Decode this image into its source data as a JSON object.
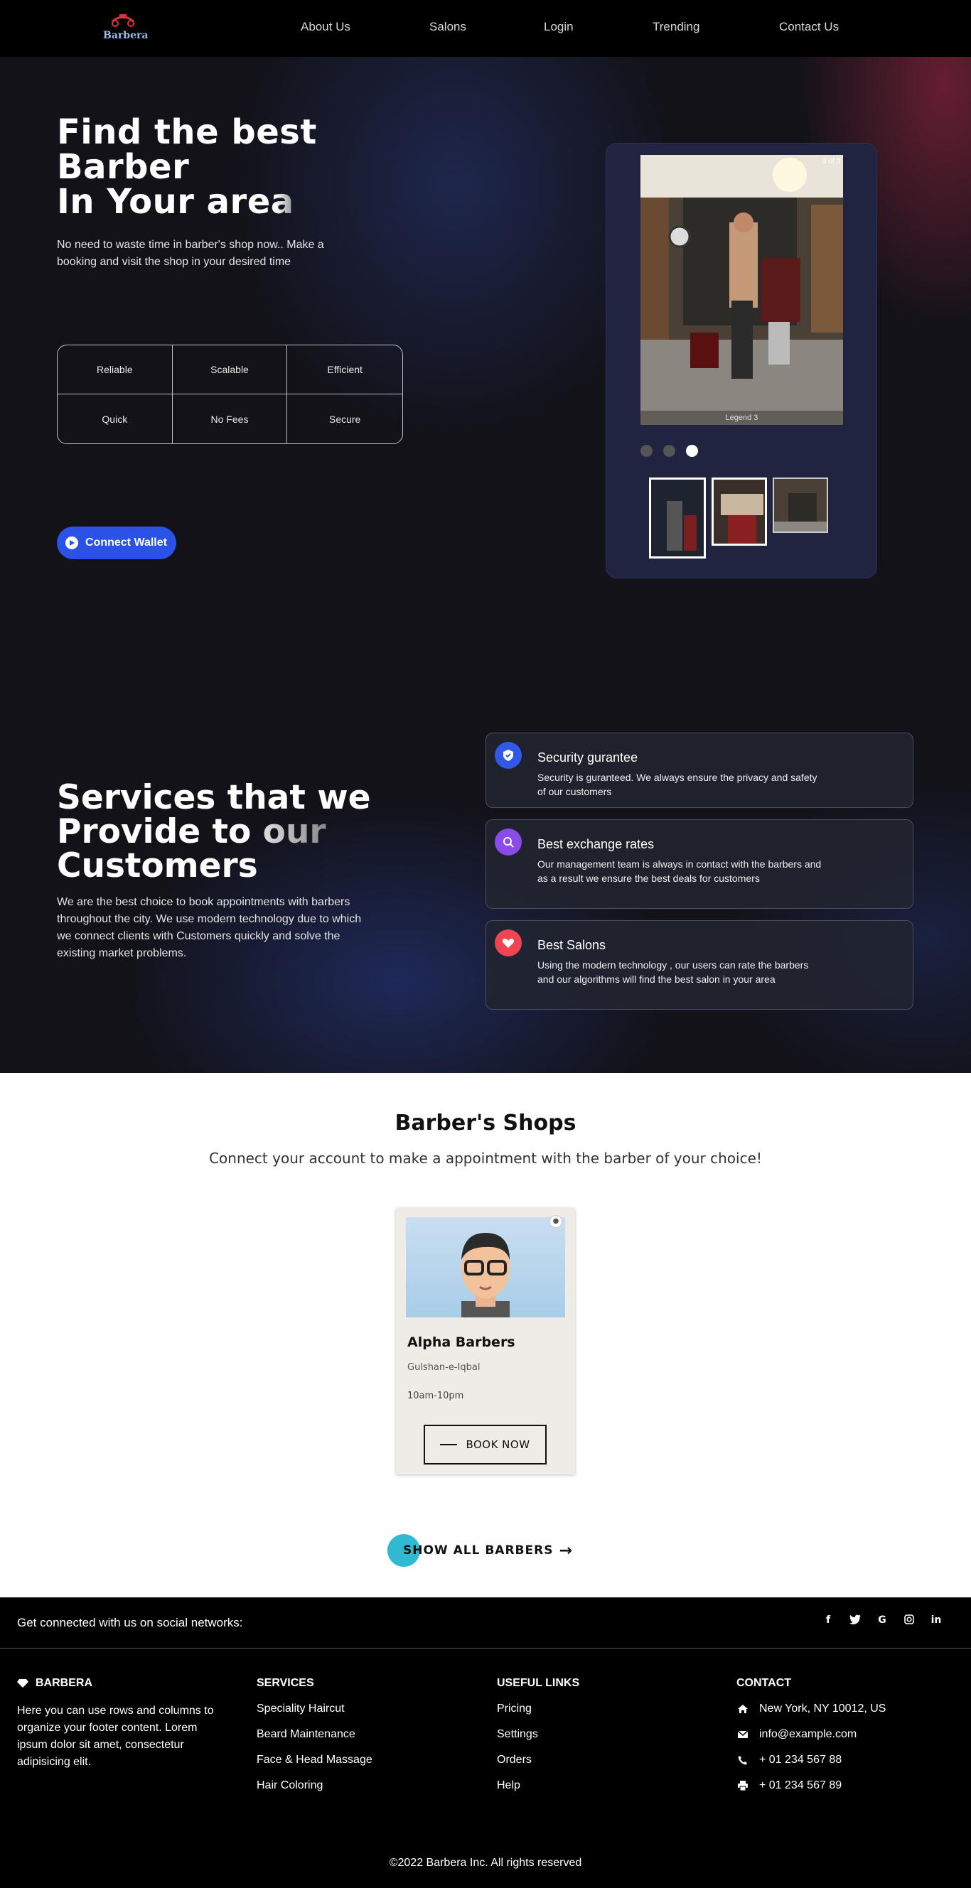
{
  "nav": {
    "logo_text": "Barbera",
    "items": [
      "About Us",
      "Salons",
      "Login",
      "Trending",
      "Contact Us"
    ]
  },
  "hero": {
    "title_line1": "Find the best",
    "title_line2": "Barber",
    "title_line3a": "In Your ar",
    "title_line3b": "ea",
    "subtitle": "No need to waste time in barber's shop now.. Make a booking and visit the shop in your desired time",
    "features": [
      "Reliable",
      "Scalable",
      "Efficient",
      "Quick",
      "No Fees",
      "Secure"
    ],
    "wallet_button": "Connect Wallet"
  },
  "carousel": {
    "counter": "3 of 3",
    "legend": "Legend 3",
    "active_slide": 3
  },
  "services": {
    "title_line1": "Services that we",
    "title_line2a": "Provide to ",
    "title_line2b": "our",
    "title_line3": "Customers",
    "subtitle": "We are the best choice to book appointments with barbers throughout the city. We use modern technology due to which we connect clients with Customers quickly and solve the existing market problems.",
    "cards": [
      {
        "title": "Security gurantee",
        "text": "Security is guranteed. We always ensure the privacy and safety of our customers",
        "icon": "shield-icon",
        "color": "#3159e6"
      },
      {
        "title": "Best exchange rates",
        "text": "Our management team is always in contact with the barbers and as a result we ensure the best deals for customers",
        "icon": "search-icon",
        "color": "#8a4be8"
      },
      {
        "title": "Best Salons",
        "text": "Using the modern technology , our users can rate the barbers and our algorithms will find the best salon in your area",
        "icon": "heart-icon",
        "color": "#ef4452"
      }
    ]
  },
  "shops": {
    "title": "Barber's Shops",
    "subtitle": "Connect your account to make a appointment with the barber of your choice!",
    "card": {
      "name": "Alpha Barbers",
      "location": "Gulshan-e-Iqbal",
      "hours": "10am-10pm",
      "button": "BOOK NOW"
    },
    "show_all": "SHOW ALL BARBERS"
  },
  "footer": {
    "social_text": "Get connected with us on social networks:",
    "social_icons": [
      "facebook-icon",
      "twitter-icon",
      "google-icon",
      "instagram-icon",
      "linkedin-icon"
    ],
    "brand": {
      "heading": "BARBERA",
      "text": "Here you can use rows and columns to organize your footer content. Lorem ipsum dolor sit amet, consectetur adipisicing elit."
    },
    "services": {
      "heading": "SERVICES",
      "links": [
        "Speciality Haircut",
        "Beard Maintenance",
        "Face & Head Massage",
        "Hair Coloring"
      ]
    },
    "useful": {
      "heading": "USEFUL LINKS",
      "links": [
        "Pricing",
        "Settings",
        "Orders",
        "Help"
      ]
    },
    "contact": {
      "heading": "CONTACT",
      "address": "New York, NY 10012, US",
      "email": "info@example.com",
      "phone": "+ 01 234 567 88",
      "fax": "+ 01 234 567 89"
    },
    "copyright": "©2022 Barbera Inc. All rights reserved"
  },
  "colors": {
    "accent_blue": "#2a52e6",
    "teal": "#2fb9d3",
    "hero_bg": "#121218"
  }
}
